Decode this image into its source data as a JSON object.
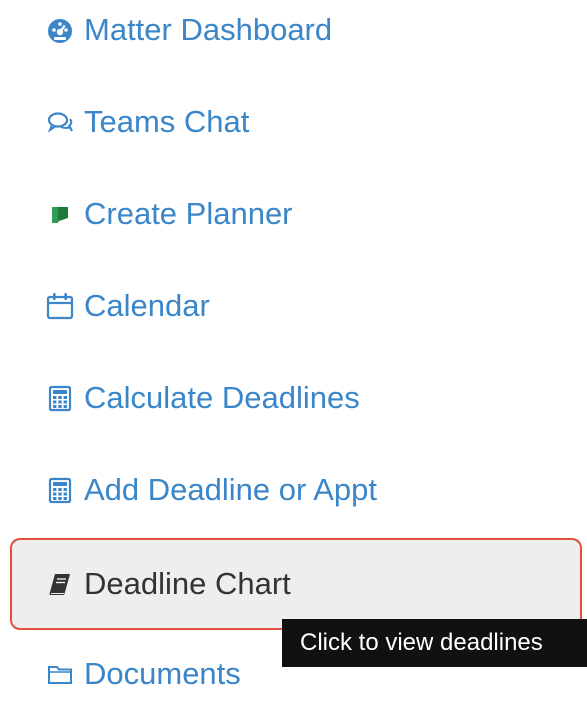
{
  "menu": {
    "items": [
      {
        "label": "Matter Dashboard",
        "icon": "dashboard-icon"
      },
      {
        "label": "Teams Chat",
        "icon": "chat-icon"
      },
      {
        "label": "Create Planner",
        "icon": "planner-icon"
      },
      {
        "label": "Calendar",
        "icon": "calendar-icon"
      },
      {
        "label": "Calculate Deadlines",
        "icon": "calculator-icon"
      },
      {
        "label": "Add Deadline or Appt",
        "icon": "calculator-icon"
      },
      {
        "label": "Deadline Chart",
        "icon": "book-icon"
      },
      {
        "label": "Documents",
        "icon": "folder-icon"
      }
    ]
  },
  "tooltip": {
    "text": "Click to view deadlines"
  },
  "colors": {
    "link": "#3a86c8",
    "active_text": "#333333",
    "active_bg": "#eeeeee",
    "highlight_border": "#e0503a",
    "tooltip_bg": "#111111",
    "planner_green": "#1f7a3a"
  }
}
